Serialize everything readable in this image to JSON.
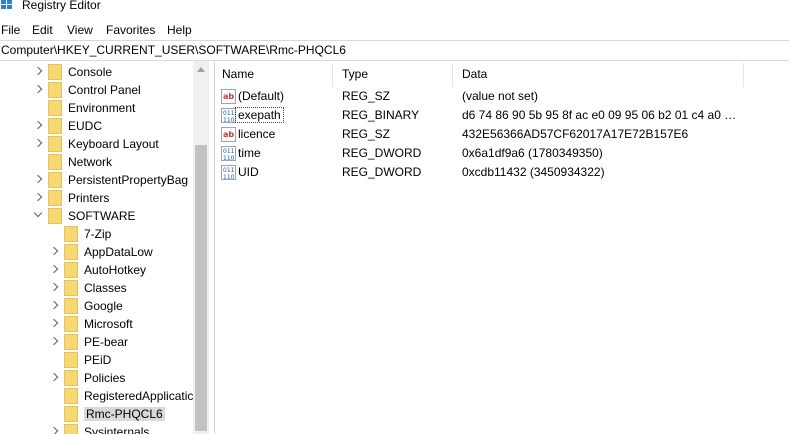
{
  "window": {
    "title": "Registry Editor",
    "icon": "registry-editor-icon"
  },
  "menu": [
    "File",
    "Edit",
    "View",
    "Favorites",
    "Help"
  ],
  "address": "Computer\\HKEY_CURRENT_USER\\SOFTWARE\\Rmc-PHQCL6",
  "tree": [
    {
      "label": "Console",
      "expander": "right"
    },
    {
      "label": "Control Panel",
      "expander": "right"
    },
    {
      "label": "Environment",
      "expander": "none"
    },
    {
      "label": "EUDC",
      "expander": "right"
    },
    {
      "label": "Keyboard Layout",
      "expander": "right"
    },
    {
      "label": "Network",
      "expander": "none"
    },
    {
      "label": "PersistentPropertyBag",
      "expander": "right"
    },
    {
      "label": "Printers",
      "expander": "right"
    },
    {
      "label": "SOFTWARE",
      "expander": "down"
    },
    {
      "label": "7-Zip",
      "expander": "none"
    },
    {
      "label": "AppDataLow",
      "expander": "right"
    },
    {
      "label": "AutoHotkey",
      "expander": "right"
    },
    {
      "label": "Classes",
      "expander": "right"
    },
    {
      "label": "Google",
      "expander": "right"
    },
    {
      "label": "Microsoft",
      "expander": "right"
    },
    {
      "label": "PE-bear",
      "expander": "right"
    },
    {
      "label": "PEiD",
      "expander": "none"
    },
    {
      "label": "Policies",
      "expander": "right"
    },
    {
      "label": "RegisteredApplicatic",
      "expander": "none"
    },
    {
      "label": "Rmc-PHQCL6",
      "expander": "none",
      "selected": true
    },
    {
      "label": "Sysinternals",
      "expander": "right"
    }
  ],
  "columns": {
    "name": "Name",
    "type": "Type",
    "data": "Data"
  },
  "values": [
    {
      "name": "(Default)",
      "type": "REG_SZ",
      "data": "(value not set)",
      "icon": "string"
    },
    {
      "name": "exepath",
      "type": "REG_BINARY",
      "data": "d6 74 86 90 5b 95 8f ac e0 09 95 06 b2 01 c4 a0 75 c...",
      "icon": "binary",
      "focused": true
    },
    {
      "name": "licence",
      "type": "REG_SZ",
      "data": "432E56366AD57CF62017A17E72B157E6",
      "icon": "string"
    },
    {
      "name": "time",
      "type": "REG_DWORD",
      "data": "0x6a1df9a6 (1780349350)",
      "icon": "binary"
    },
    {
      "name": "UID",
      "type": "REG_DWORD",
      "data": "0xcdb11432 (3450934322)",
      "icon": "binary"
    }
  ],
  "icon_glyphs": {
    "string": "ab",
    "binary": "011\n110"
  },
  "colors": {
    "folder": "#f8d775",
    "selection": "#d9d9d9",
    "string_icon": "#c0392b",
    "binary_icon": "#1f5fbf"
  }
}
